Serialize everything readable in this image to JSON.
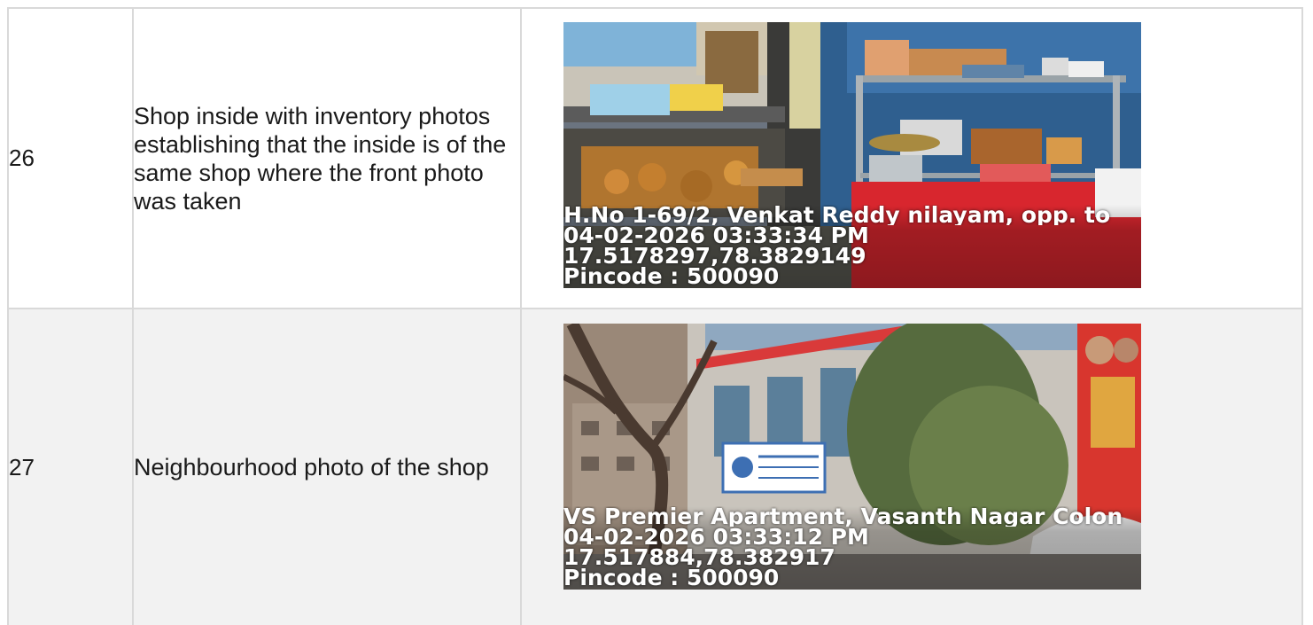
{
  "rows": [
    {
      "number": "26",
      "description": "Shop inside with inventory photos establishing that the inside is of the same shop where the front photo was taken",
      "photo_stamp": {
        "address": "H.No 1-69/2, Venkat Reddy nilayam, opp. to",
        "datetime": "04-02-2026 03:33:34 PM",
        "coords": "17.5178297,78.3829149",
        "pincode": "Pincode : 500090"
      }
    },
    {
      "number": "27",
      "description": "Neighbourhood photo of the shop",
      "photo_stamp": {
        "address": "VS Premier Apartment, Vasanth Nagar Colon",
        "datetime": "04-02-2026 03:33:12 PM",
        "coords": "17.517884,78.382917",
        "pincode": "Pincode : 500090"
      }
    }
  ]
}
